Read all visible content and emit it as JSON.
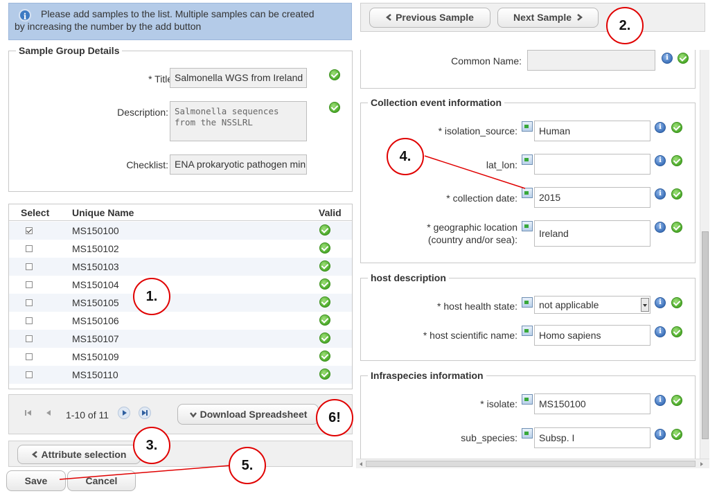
{
  "banner": {
    "line1": "Please add samples to the list. Multiple samples can be created",
    "line2": "by increasing the number by the add button"
  },
  "group_details": {
    "legend": "Sample Group Details",
    "title_label": "* Title:",
    "title_value": "Salmonella WGS from Ireland",
    "description_label": "Description:",
    "description_line1": "Salmonella sequences",
    "description_line2": "from the NSSLRL",
    "checklist_label": "Checklist:",
    "checklist_value": "ENA prokaryotic pathogen mini"
  },
  "grid": {
    "col_select": "Select",
    "col_name": "Unique Name",
    "col_valid": "Valid",
    "rows": [
      {
        "name": "MS150100",
        "selected": true
      },
      {
        "name": "MS150102",
        "selected": false
      },
      {
        "name": "MS150103",
        "selected": false
      },
      {
        "name": "MS150104",
        "selected": false
      },
      {
        "name": "MS150105",
        "selected": false
      },
      {
        "name": "MS150106",
        "selected": false
      },
      {
        "name": "MS150107",
        "selected": false
      },
      {
        "name": "MS150109",
        "selected": false
      },
      {
        "name": "MS150110",
        "selected": false
      }
    ]
  },
  "pager": {
    "range": "1-10 of 11",
    "download_label": "Download Spreadsheet"
  },
  "buttons": {
    "attribute_selection": "Attribute selection",
    "save": "Save",
    "cancel": "Cancel",
    "previous_sample": "Previous Sample",
    "next_sample": "Next Sample"
  },
  "sample_form": {
    "common_name_label": "Common Name:",
    "collection": {
      "legend": "Collection event information",
      "isolation_source_label": "* isolation_source:",
      "isolation_source_value": "Human",
      "lat_lon_label": "lat_lon:",
      "lat_lon_value": "",
      "collection_date_label": "* collection date:",
      "collection_date_value": "2015",
      "geo_label_line1": "* geographic location",
      "geo_label_line2": "(country and/or sea):",
      "geo_value": "Ireland"
    },
    "host": {
      "legend": "host description",
      "health_label": "* host health state:",
      "health_value": "not applicable",
      "scientific_label": "* host scientific name:",
      "scientific_value": "Homo sapiens"
    },
    "infraspecies": {
      "legend": "Infraspecies information",
      "isolate_label": "* isolate:",
      "isolate_value": "MS150100",
      "sub_species_label": "sub_species:",
      "sub_species_value": "Subsp. I"
    }
  },
  "callouts": [
    "1.",
    "2.",
    "3.",
    "4.",
    "5.",
    "6!"
  ],
  "colors": {
    "banner_bg": "#b4cbe8",
    "callout_red": "#e00000",
    "valid_green": "#4caa2a",
    "info_blue": "#3a6fb8"
  }
}
